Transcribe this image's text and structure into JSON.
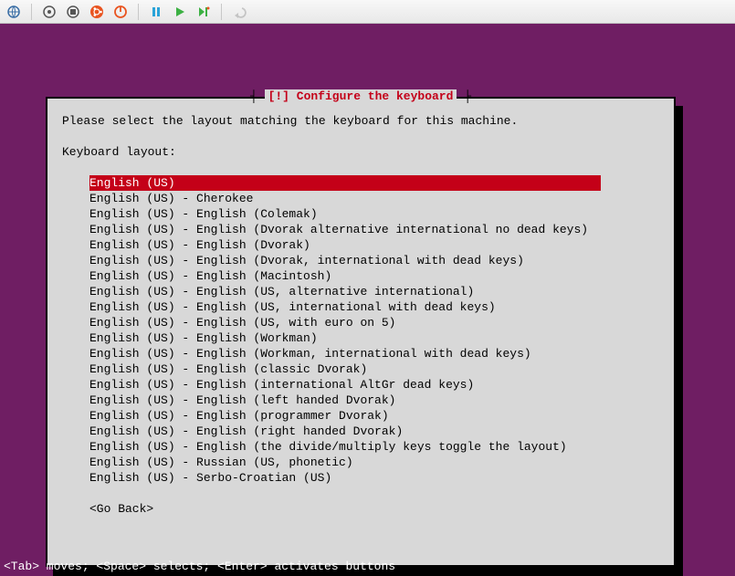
{
  "toolbar": {
    "icons": [
      "globe",
      "circle-dot",
      "record",
      "ubuntu",
      "power",
      "pause",
      "play",
      "play-dot",
      "undo"
    ]
  },
  "dialog": {
    "title": "[!] Configure the keyboard",
    "prompt": "Please select the layout matching the keyboard for this machine.",
    "label": "Keyboard layout:",
    "selected_index": 0,
    "layouts": [
      "English (US)",
      "English (US) - Cherokee",
      "English (US) - English (Colemak)",
      "English (US) - English (Dvorak alternative international no dead keys)",
      "English (US) - English (Dvorak)",
      "English (US) - English (Dvorak, international with dead keys)",
      "English (US) - English (Macintosh)",
      "English (US) - English (US, alternative international)",
      "English (US) - English (US, international with dead keys)",
      "English (US) - English (US, with euro on 5)",
      "English (US) - English (Workman)",
      "English (US) - English (Workman, international with dead keys)",
      "English (US) - English (classic Dvorak)",
      "English (US) - English (international AltGr dead keys)",
      "English (US) - English (left handed Dvorak)",
      "English (US) - English (programmer Dvorak)",
      "English (US) - English (right handed Dvorak)",
      "English (US) - English (the divide/multiply keys toggle the layout)",
      "English (US) - Russian (US, phonetic)",
      "English (US) - Serbo-Croatian (US)"
    ],
    "go_back": "<Go Back>"
  },
  "help_bar": "<Tab> moves; <Space> selects; <Enter> activates buttons"
}
